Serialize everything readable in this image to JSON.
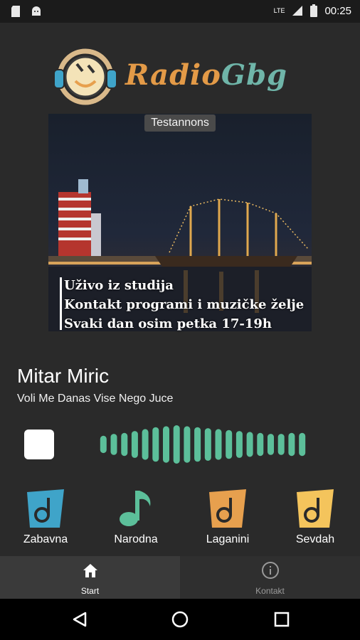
{
  "status_bar": {
    "time": "00:25",
    "network": "LTE"
  },
  "app": {
    "name_part1": "Radio",
    "name_part2": "Gbg"
  },
  "banner": {
    "ad_label": "Testannons",
    "lines": [
      "Uživo iz studija",
      "Kontakt programi i muzičke želje",
      "Svaki dan osim petka 17-19h"
    ]
  },
  "now_playing": {
    "artist": "Mitar Miric",
    "song": "Voli Me Danas Vise Nego Juce"
  },
  "visualizer": {
    "bar_levels": [
      0.45,
      0.55,
      0.6,
      0.7,
      0.8,
      0.9,
      0.95,
      1.0,
      0.95,
      0.9,
      0.85,
      0.8,
      0.75,
      0.7,
      0.65,
      0.6,
      0.55,
      0.55,
      0.6,
      0.6
    ],
    "color": "#5cbf9a"
  },
  "categories": [
    {
      "label": "Zabavna",
      "color": "#3fa4c9"
    },
    {
      "label": "Narodna",
      "color": "#5cbf9a"
    },
    {
      "label": "Laganini",
      "color": "#e7a04e"
    },
    {
      "label": "Sevdah",
      "color": "#f4c45c"
    }
  ],
  "bottom_nav": [
    {
      "label": "Start",
      "icon": "home-icon",
      "active": true
    },
    {
      "label": "Kontakt",
      "icon": "info-icon",
      "active": false
    }
  ]
}
